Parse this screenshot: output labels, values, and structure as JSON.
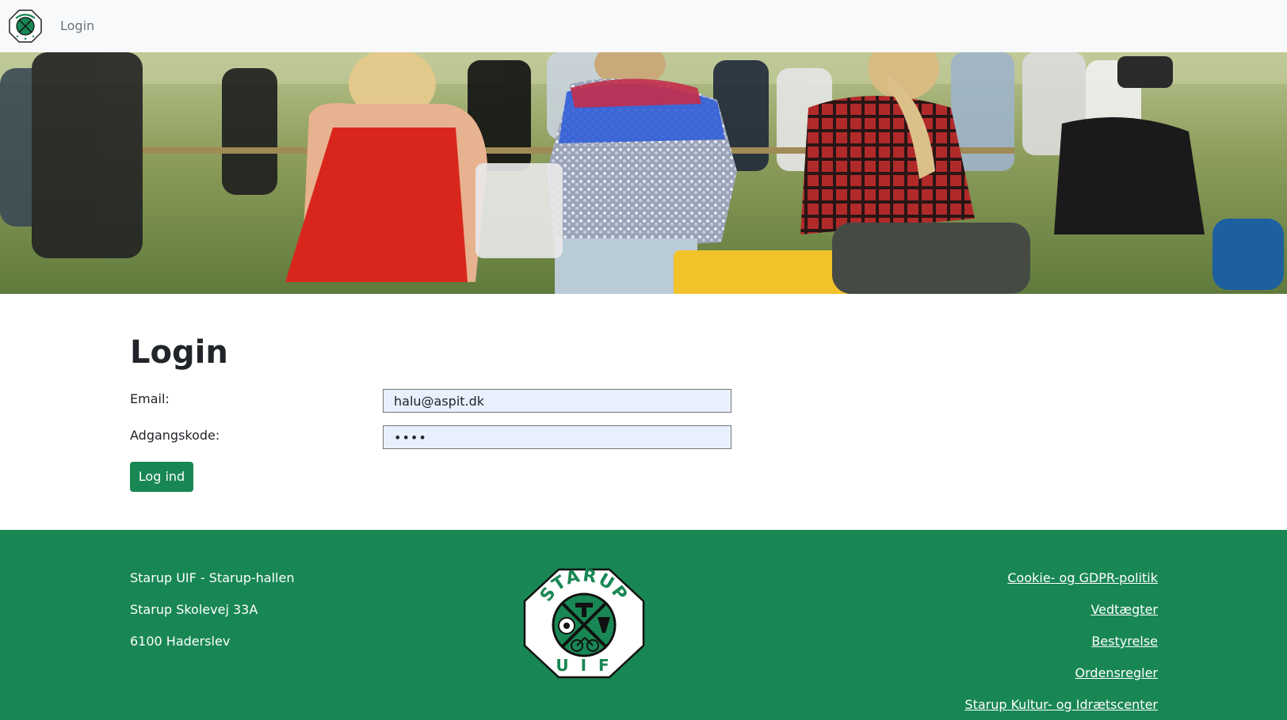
{
  "nav": {
    "logo_text": "STARUP UIF",
    "login_link": "Login"
  },
  "hero": {
    "image_subject": "crowd-sitting-on-grass"
  },
  "main": {
    "title": "Login",
    "email_label": "Email:",
    "email_value": "halu@aspit.dk",
    "password_label": "Adgangskode:",
    "password_value": "1234",
    "submit_label": "Log ind"
  },
  "footer": {
    "address": [
      "Starup UIF - Starup-hallen",
      "Starup Skolevej 33A",
      "6100 Haderslev"
    ],
    "logo_top": "STARUP",
    "logo_bottom": "U I F",
    "links": [
      "Cookie- og GDPR-politik",
      "Vedtægter",
      "Bestyrelse",
      "Ordensregler",
      "Starup Kultur- og Idrætscenter"
    ]
  },
  "colors": {
    "brand_green": "#198754",
    "navbar_bg": "#f8f9fa",
    "input_autofill_bg": "#e8f0fe"
  }
}
